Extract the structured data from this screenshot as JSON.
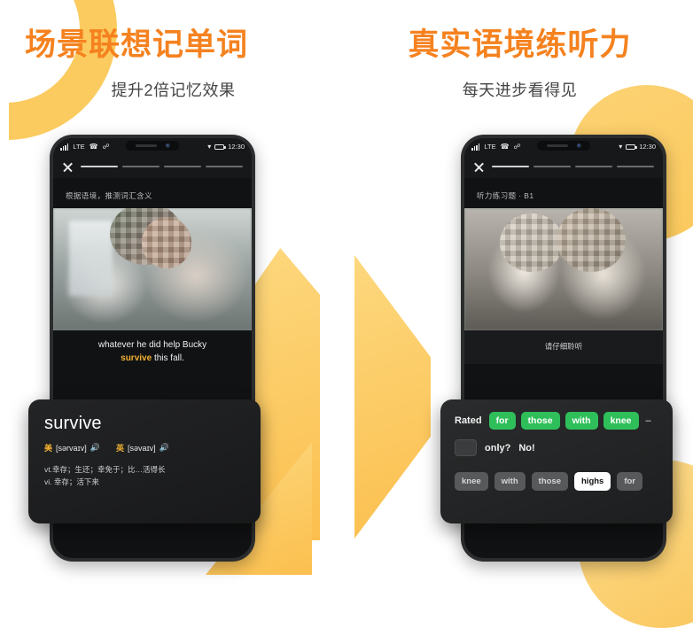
{
  "theme": {
    "accent_orange": "#F5821F",
    "deco_yellow": "#FBC95C",
    "chip_green": "#2FBF5A",
    "highlight_gold": "#F2B233",
    "screen_dark": "#111213"
  },
  "panels": [
    {
      "headline": "场景联想记单词",
      "subline": "提升2倍记忆效果",
      "phone": {
        "status": {
          "network": "LTE",
          "phone_icon": "phone-signal-icon",
          "bluetooth_icon": "bluetooth-icon",
          "wifi_icon": "wifi-icon",
          "battery_icon": "battery-icon",
          "time": "12:30"
        },
        "close_label": "close-icon",
        "progress_total": 4,
        "progress_done": 1,
        "hint": "根据语境，推测词汇含义",
        "subtitle_line1": "whatever he did help Bucky",
        "subtitle_highlight": "survive",
        "subtitle_line2_rest": " this fall."
      },
      "card": {
        "word": "survive",
        "pron": [
          {
            "region": "美",
            "ipa": "[sərvaɪv]",
            "speaker": "speaker-icon"
          },
          {
            "region": "英",
            "ipa": "[səvaɪv]",
            "speaker": "speaker-icon"
          }
        ],
        "definitions": [
          "vt.幸存；生还；幸免于；比…活得长",
          "vi. 幸存；活下来"
        ]
      }
    },
    {
      "headline": "真实语境练听力",
      "subline": "每天进步看得见",
      "phone": {
        "status": {
          "network": "LTE",
          "phone_icon": "phone-signal-icon",
          "bluetooth_icon": "bluetooth-icon",
          "wifi_icon": "wifi-icon",
          "battery_icon": "battery-icon",
          "time": "12:30"
        },
        "close_label": "close-icon",
        "progress_total": 4,
        "progress_done": 1,
        "hint": "听力练习题 · B1",
        "caption": "请仔细聆听"
      },
      "exercise": {
        "lead": "Rated",
        "filled": [
          "for",
          "those",
          "with",
          "knee"
        ],
        "dash": "–",
        "blank": "",
        "tail_1": "only?",
        "tail_2": "No!",
        "bank": [
          {
            "label": "knee",
            "state": "default"
          },
          {
            "label": "with",
            "state": "default"
          },
          {
            "label": "those",
            "state": "default"
          },
          {
            "label": "highs",
            "state": "selected"
          },
          {
            "label": "for",
            "state": "default"
          }
        ]
      }
    }
  ]
}
